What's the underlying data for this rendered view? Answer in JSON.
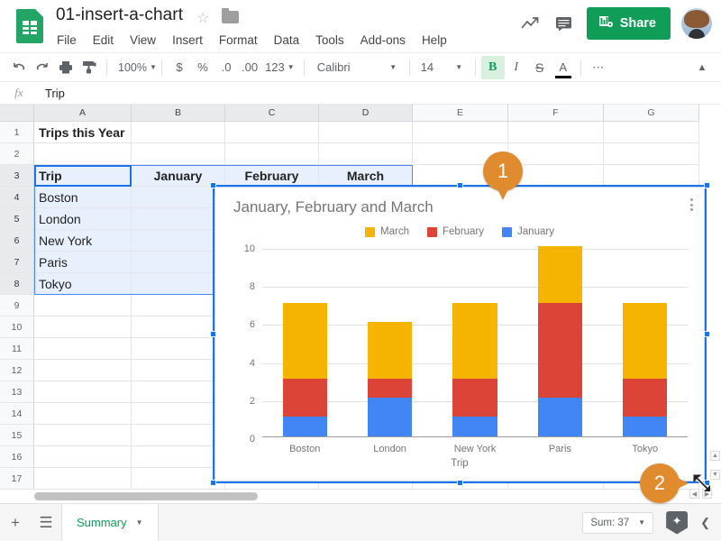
{
  "app": {
    "doc_title": "01-insert-a-chart",
    "star_icon": "star-outline-icon",
    "folder_icon": "folder-icon",
    "logo_icon": "sheets-logo-icon"
  },
  "menubar": {
    "items": [
      {
        "label": "File"
      },
      {
        "label": "Edit"
      },
      {
        "label": "View"
      },
      {
        "label": "Insert"
      },
      {
        "label": "Format"
      },
      {
        "label": "Data"
      },
      {
        "label": "Tools"
      },
      {
        "label": "Add-ons"
      },
      {
        "label": "Help"
      }
    ]
  },
  "header_actions": {
    "trend_icon": "trending-up-icon",
    "comment_icon": "comment-icon",
    "share_label": "Share",
    "share_icon": "share-lock-icon",
    "share_color": "#0f9d58",
    "avatar": "user-avatar"
  },
  "toolbar": {
    "undo_icon": "undo-icon",
    "redo_icon": "redo-icon",
    "print_icon": "print-icon",
    "paint_icon": "paint-format-icon",
    "zoom_value": "100%",
    "currency_icon": "$",
    "percent_icon": "%",
    "decrease_decimal_icon": ".0",
    "increase_decimal_icon": ".00",
    "number_format_label": "123",
    "font_family_value": "Calibri",
    "font_size_value": "14",
    "bold_label": "B",
    "italic_label": "I",
    "strikethrough_label": "S",
    "text_color_label": "A",
    "more_label": "⋯",
    "collapse_icon": "chevron-up-icon"
  },
  "formula_bar": {
    "fx_label": "fx",
    "value": "Trip"
  },
  "grid": {
    "columns": [
      "A",
      "B",
      "C",
      "D",
      "E",
      "F",
      "G"
    ],
    "selected_columns": [
      "A",
      "B",
      "C",
      "D"
    ],
    "rows": [
      "1",
      "2",
      "3",
      "4",
      "5",
      "6",
      "7",
      "8",
      "9",
      "10",
      "11",
      "12",
      "13",
      "14",
      "15",
      "16",
      "17"
    ],
    "selected_rows": [
      "3",
      "4",
      "5",
      "6",
      "7",
      "8"
    ],
    "cells": {
      "A1": "Trips this Year",
      "A3": "Trip",
      "B3": "January",
      "C3": "February",
      "D3": "March",
      "A4": "Boston",
      "A5": "London",
      "A6": "New York",
      "A7": "Paris",
      "A8": "Tokyo"
    }
  },
  "chart": {
    "kebab_icon": "more-options-icon",
    "selected": true
  },
  "chart_data": {
    "type": "bar",
    "stacked": true,
    "title": "January, February and March",
    "xlabel": "Trip",
    "ylabel": "",
    "categories": [
      "Boston",
      "London",
      "New York",
      "Paris",
      "Tokyo"
    ],
    "series": [
      {
        "name": "January",
        "color": "#4285f4",
        "values": [
          1,
          2,
          1,
          2,
          1
        ]
      },
      {
        "name": "February",
        "color": "#db4437",
        "values": [
          2,
          1,
          2,
          5,
          2
        ]
      },
      {
        "name": "March",
        "color": "#f4b400",
        "values": [
          4,
          3,
          4,
          3,
          4
        ]
      }
    ],
    "legend_order": [
      "March",
      "February",
      "January"
    ],
    "legend_position": "top",
    "ylim": [
      0,
      10
    ],
    "yticks": [
      0,
      2,
      4,
      6,
      8,
      10
    ],
    "grid": true,
    "totals": [
      7,
      6,
      7,
      10,
      7
    ]
  },
  "callouts": [
    {
      "number": "1",
      "direction": "down"
    },
    {
      "number": "2",
      "direction": "right"
    }
  ],
  "bottom_bar": {
    "add_sheet_icon": "plus-icon",
    "all_sheets_icon": "list-icon",
    "sheet_tab_label": "Summary",
    "sheet_tab_caret": "chevron-down-icon",
    "sum_label": "Sum: 37",
    "sum_caret": "chevron-down-icon",
    "explore_icon": "explore-icon",
    "collapse_icon": "chevron-left-icon"
  }
}
